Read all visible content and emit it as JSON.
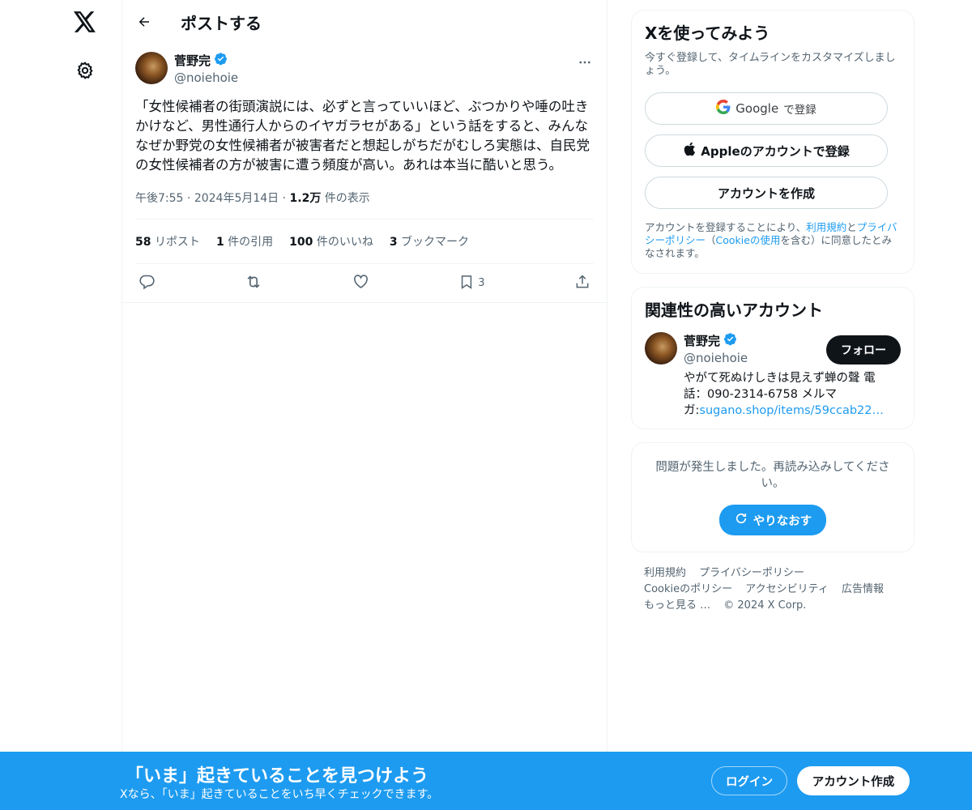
{
  "nav": {
    "logo_icon": "x-logo-icon",
    "settings_icon": "gear-icon"
  },
  "header": {
    "title": "ポストする"
  },
  "post": {
    "author_name": "菅野完",
    "author_handle": "@noiehoie",
    "text": "「女性候補者の街頭演説には、必ずと言っていいほど、ぶつかりや唾の吐きかけなど、男性通行人からのイヤガラセがある」という話をすると、みんななぜか野党の女性候補者が被害者だと想起しがちだがむしろ実態は、自民党の女性候補者の方が被害に遭う頻度が高い。あれは本当に酷いと思う。",
    "time": "午後7:55",
    "date": "2024年5月14日",
    "views_count": "1.2万",
    "views_label": "件の表示",
    "stats": {
      "reposts_count": "58",
      "reposts_label": "リポスト",
      "quotes_count": "1",
      "quotes_label": "件の引用",
      "likes_count": "100",
      "likes_label": "件のいいね",
      "bookmarks_count": "3",
      "bookmarks_label": "ブックマーク"
    },
    "bookmark_action_count": "3"
  },
  "signup_card": {
    "title": "Xを使ってみよう",
    "subtitle": "今すぐ登録して、タイムラインをカスタマイズしましょう。",
    "google_brand": "Google",
    "google_suffix": "で登録",
    "apple_label": "Appleのアカウントで登録",
    "create_label": "アカウントを作成",
    "legal_prefix": "アカウントを登録することにより、",
    "legal_terms": "利用規約",
    "legal_and": "と",
    "legal_privacy": "プライバシーポリシー",
    "legal_open": "（",
    "legal_cookie": "Cookieの使用",
    "legal_suffix": "を含む）に同意したとみなされます。"
  },
  "related": {
    "title": "関連性の高いアカウント",
    "name": "菅野完",
    "handle": "@noiehoie",
    "follow_label": "フォロー",
    "bio_text": "やがて死ぬけしきは見えず蝉の聲 電話：090-2314-6758 メルマガ:",
    "bio_link": "sugano.shop/items/59ccab22…"
  },
  "error_card": {
    "message": "問題が発生しました。再読み込みしてください。",
    "retry_label": "やりなおす"
  },
  "footer": {
    "links_row1": [
      "利用規約",
      "プライバシーポリシー"
    ],
    "links_row2": [
      "Cookieのポリシー",
      "アクセシビリティ",
      "広告情報"
    ],
    "more": "もっと見る …",
    "copyright": "© 2024 X Corp."
  },
  "banner": {
    "title": "「いま」起きていることを見つけよう",
    "subtitle": "Xなら、「いま」起きていることをいち早くチェックできます。",
    "login_label": "ログイン",
    "signup_label": "アカウント作成"
  },
  "colors": {
    "accent": "#1d9bf0",
    "text": "#0f1419",
    "muted": "#536471",
    "border": "#eff3f4"
  }
}
